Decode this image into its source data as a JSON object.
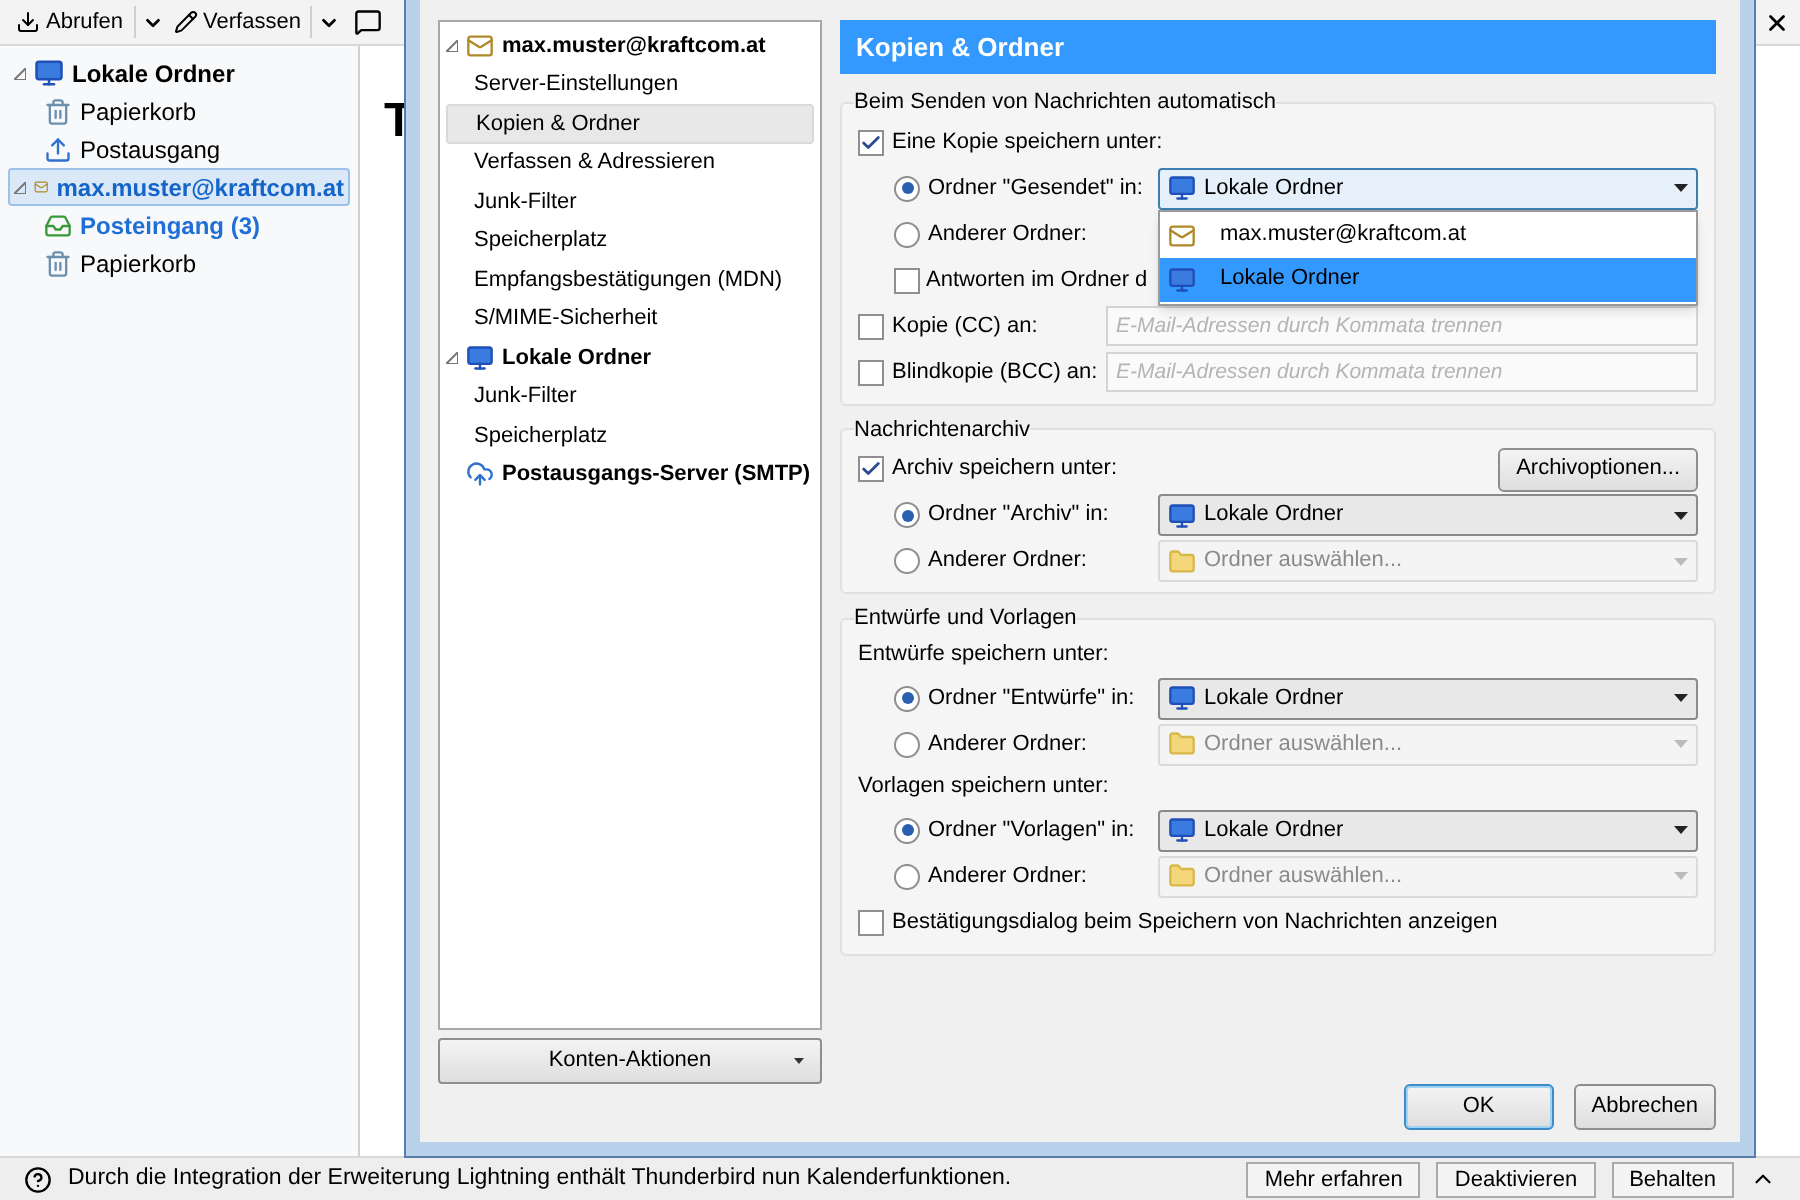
{
  "toolbar": {
    "buttons": [
      {
        "label": "Abrufen"
      },
      {
        "label": "Verfassen"
      }
    ]
  },
  "folder_pane": {
    "nodes": [
      {
        "label": "Lokale Ordner",
        "kind": "local",
        "expanded": true,
        "selected": false,
        "children": [
          {
            "label": "Papierkorb",
            "kind": "trash",
            "unread": false
          },
          {
            "label": "Postausgang",
            "kind": "outbox",
            "unread": false
          }
        ]
      },
      {
        "label": "max.muster@kraftcom.at",
        "kind": "account",
        "expanded": true,
        "selected": true,
        "children": [
          {
            "label": "Posteingang (3)",
            "kind": "inbox",
            "unread": true
          },
          {
            "label": "Papierkorb",
            "kind": "trash",
            "unread": false
          }
        ]
      }
    ]
  },
  "content": {
    "heading": "T"
  },
  "notification": {
    "text": "Durch die Integration der Erweiterung Lightning enthält Thunderbird nun Kalenderfunktionen.",
    "buttons": [
      "Mehr erfahren",
      "Deaktivieren",
      "Behalten"
    ]
  },
  "dialog": {
    "tree": [
      {
        "label": "max.muster@kraftcom.at",
        "kind": "account",
        "expanded": true,
        "children": [
          {
            "label": "Server-Einstellungen",
            "selected": false
          },
          {
            "label": "Kopien & Ordner",
            "selected": true
          },
          {
            "label": "Verfassen & Adressieren",
            "selected": false
          },
          {
            "label": "Junk-Filter",
            "selected": false
          },
          {
            "label": "Speicherplatz",
            "selected": false
          },
          {
            "label": "Empfangsbestätigungen (MDN)",
            "selected": false
          },
          {
            "label": "S/MIME-Sicherheit",
            "selected": false
          }
        ]
      },
      {
        "label": "Lokale Ordner",
        "kind": "local",
        "expanded": true,
        "children": [
          {
            "label": "Junk-Filter",
            "selected": false
          },
          {
            "label": "Speicherplatz",
            "selected": false
          }
        ]
      },
      {
        "label": "Postausgangs-Server (SMTP)",
        "kind": "server",
        "expanded": false
      }
    ],
    "account_actions": "Konten-Aktionen",
    "panel": {
      "title": "Kopien & Ordner",
      "sections": [
        {
          "title": "Beim Senden von Nachrichten automatisch",
          "rows": [
            {
              "kind": "checkbox",
              "label": "Eine Kopie speichern unter:",
              "checked": true
            },
            {
              "kind": "radio",
              "label": "Ordner \"Gesendet\" in:",
              "selected": true,
              "select": {
                "value": "Lokale Ordner",
                "kind": "local",
                "disabled": false,
                "expanded": true,
                "options": [
                  {
                    "label": "max.muster@kraftcom.at",
                    "kind": "account",
                    "selected": false
                  },
                  {
                    "label": "Lokale Ordner",
                    "kind": "local",
                    "selected": true
                  }
                ]
              }
            },
            {
              "kind": "radio",
              "label": "Anderer Ordner:",
              "selected": false
            },
            {
              "kind": "sub_checkbox",
              "label": "Antworten im Ordner d",
              "checked": false
            },
            {
              "kind": "email",
              "label": "Kopie (CC) an:",
              "checked": false,
              "placeholder": "E-Mail-Adressen durch Kommata trennen"
            },
            {
              "kind": "email",
              "label": "Blindkopie (BCC) an:",
              "checked": false,
              "placeholder": "E-Mail-Adressen durch Kommata trennen"
            }
          ]
        },
        {
          "title": "Nachrichtenarchiv",
          "rows": [
            {
              "kind": "checkbox",
              "label": "Archiv speichern unter:",
              "checked": true,
              "button": "Archivoptionen..."
            },
            {
              "kind": "radio",
              "label": "Ordner \"Archiv\" in:",
              "selected": true,
              "select": {
                "value": "Lokale Ordner",
                "kind": "local",
                "disabled": false,
                "expanded": false
              }
            },
            {
              "kind": "radio",
              "label": "Anderer Ordner:",
              "selected": false,
              "select": {
                "value": "Ordner auswählen...",
                "kind": "folder",
                "disabled": true,
                "expanded": false
              }
            }
          ]
        },
        {
          "title": "Entwürfe und Vorlagen",
          "rows": [
            {
              "kind": "label",
              "label": "Entwürfe speichern unter:"
            },
            {
              "kind": "radio",
              "label": "Ordner \"Entwürfe\" in:",
              "selected": true,
              "select": {
                "value": "Lokale Ordner",
                "kind": "local",
                "disabled": false,
                "expanded": false
              }
            },
            {
              "kind": "radio",
              "label": "Anderer Ordner:",
              "selected": false,
              "select": {
                "value": "Ordner auswählen...",
                "kind": "folder",
                "disabled": true,
                "expanded": false
              }
            },
            {
              "kind": "label",
              "label": "Vorlagen speichern unter:"
            },
            {
              "kind": "radio",
              "label": "Ordner \"Vorlagen\" in:",
              "selected": true,
              "select": {
                "value": "Lokale Ordner",
                "kind": "local",
                "disabled": false,
                "expanded": false
              }
            },
            {
              "kind": "radio",
              "label": "Anderer Ordner:",
              "selected": false,
              "select": {
                "value": "Ordner auswählen...",
                "kind": "folder",
                "disabled": true,
                "expanded": false
              }
            },
            {
              "kind": "checkbox",
              "label": "Bestätigungsdialog beim Speichern von Nachrichten anzeigen",
              "checked": false
            }
          ]
        }
      ]
    },
    "buttons": [
      {
        "label": "OK",
        "default": true
      },
      {
        "label": "Abbrechen",
        "default": false
      }
    ]
  }
}
